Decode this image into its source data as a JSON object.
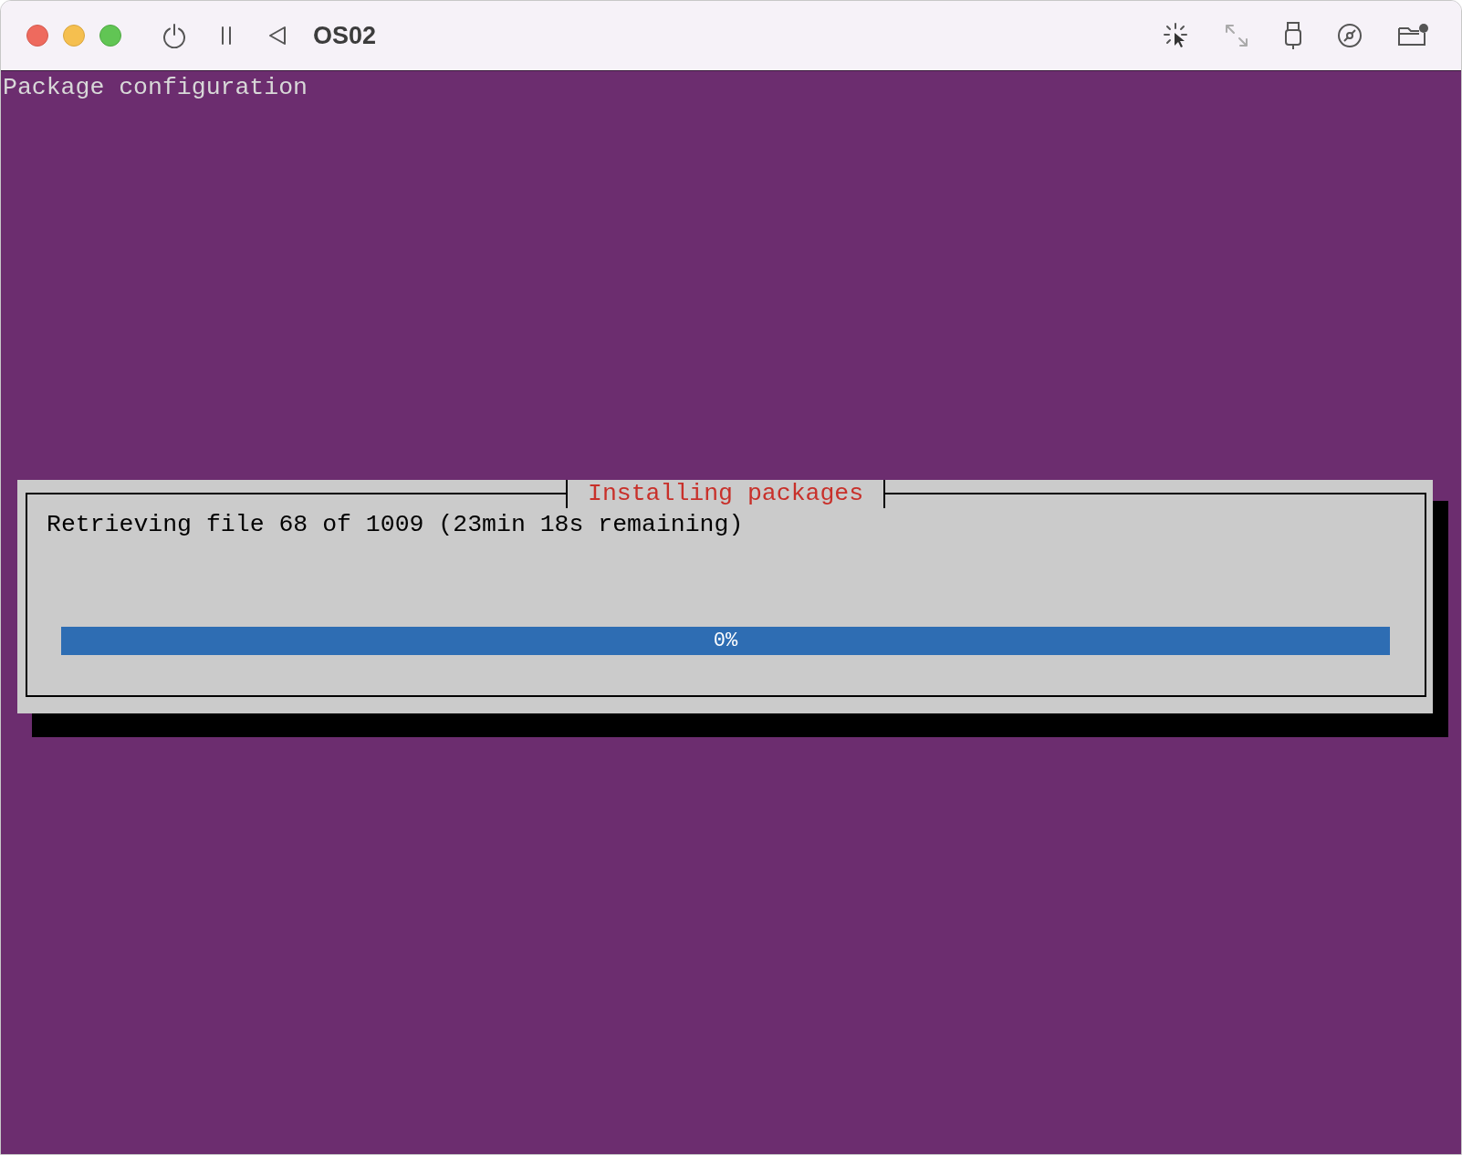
{
  "window": {
    "title": "OS02"
  },
  "console": {
    "header": "Package configuration"
  },
  "dialog": {
    "title": "Installing packages",
    "message": "Retrieving file 68 of 1009 (23min 18s remaining)",
    "progress": {
      "level": 0,
      "reading": "0%"
    }
  }
}
